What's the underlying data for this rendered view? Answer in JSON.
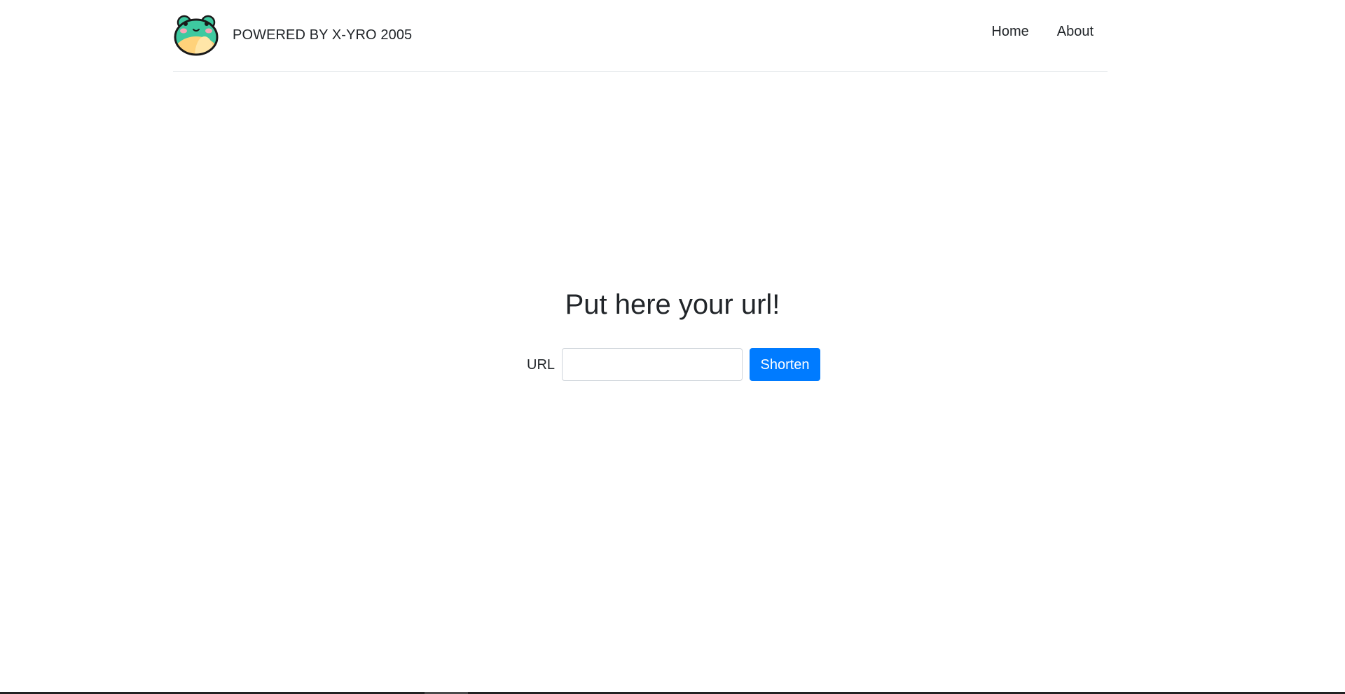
{
  "header": {
    "brand_text": "POWERED BY X-YRO 2005",
    "logo_icon": "frog-logo-icon",
    "nav": [
      {
        "label": "Home"
      },
      {
        "label": "About"
      }
    ]
  },
  "main": {
    "heading": "Put here your url!",
    "form": {
      "url_label": "URL",
      "url_value": "",
      "url_placeholder": "",
      "submit_label": "Shorten"
    }
  },
  "colors": {
    "accent": "#007bff",
    "text": "#212529",
    "divider": "#dee2e6",
    "logo_green": "#3ec9a0",
    "logo_yellow": "#ffd27a"
  }
}
